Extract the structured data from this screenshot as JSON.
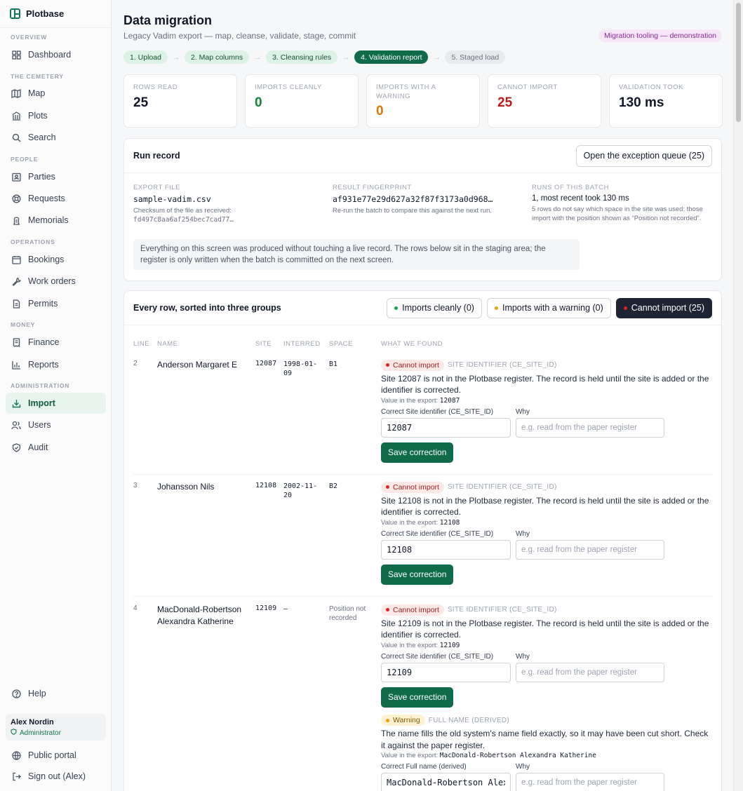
{
  "brand": "Plotbase",
  "nav": {
    "sections": [
      "OVERVIEW",
      "THE CEMETERY",
      "PEOPLE",
      "OPERATIONS",
      "MONEY",
      "ADMINISTRATION"
    ],
    "items": [
      {
        "label": "Dashboard",
        "icon": "grid-icon"
      },
      {
        "label": "Map",
        "icon": "map-icon"
      },
      {
        "label": "Plots",
        "icon": "building-icon"
      },
      {
        "label": "Search",
        "icon": "search-icon"
      },
      {
        "label": "Parties",
        "icon": "id-card-icon"
      },
      {
        "label": "Requests",
        "icon": "lifebuoy-icon"
      },
      {
        "label": "Memorials",
        "icon": "memorial-icon"
      },
      {
        "label": "Bookings",
        "icon": "calendar-icon"
      },
      {
        "label": "Work orders",
        "icon": "wrench-icon"
      },
      {
        "label": "Permits",
        "icon": "document-icon"
      },
      {
        "label": "Finance",
        "icon": "receipt-icon"
      },
      {
        "label": "Reports",
        "icon": "bar-chart-icon"
      },
      {
        "label": "Import",
        "icon": "import-icon",
        "active": true
      },
      {
        "label": "Users",
        "icon": "users-icon"
      },
      {
        "label": "Audit",
        "icon": "shield-icon"
      }
    ],
    "help": "Help",
    "user_name": "Alex Nordin",
    "user_role": "Administrator",
    "public_portal": "Public portal",
    "sign_out": "Sign out (Alex)"
  },
  "header": {
    "title": "Data migration",
    "subtitle": "Legacy Vadim export — map, cleanse, validate, stage, commit",
    "badge": "Migration tooling — demonstration"
  },
  "steps": [
    {
      "label": "1. Upload",
      "state": "done"
    },
    {
      "label": "2. Map columns",
      "state": "done"
    },
    {
      "label": "3. Cleansing rules",
      "state": "done"
    },
    {
      "label": "4. Validation report",
      "state": "current"
    },
    {
      "label": "5. Staged load",
      "state": "todo"
    }
  ],
  "stats": [
    {
      "label": "ROWS READ",
      "value": "25",
      "tone": ""
    },
    {
      "label": "IMPORTS CLEANLY",
      "value": "0",
      "tone": "green"
    },
    {
      "label": "IMPORTS WITH A WARNING",
      "value": "0",
      "tone": "orange"
    },
    {
      "label": "CANNOT IMPORT",
      "value": "25",
      "tone": "red"
    },
    {
      "label": "VALIDATION TOOK",
      "value": "130 ms",
      "tone": ""
    }
  ],
  "run_record": {
    "title": "Run record",
    "queue_button": "Open the exception queue (25)",
    "export_label": "EXPORT FILE",
    "export_value": "sample-vadim.csv",
    "export_note": "Checksum of the file as received:",
    "export_checksum": "fd497c8aa6af254bec7cad77…",
    "fingerprint_label": "RESULT FINGERPRINT",
    "fingerprint_value": "af931e77e29d627a32f87f3173a0d968…",
    "fingerprint_note": "Re-run the batch to compare this against the next run.",
    "runs_label": "RUNS OF THIS BATCH",
    "runs_value": "1, most recent took 130 ms",
    "runs_note": "5 rows do not say which space in the site was used; those import with the position shown as “Position not recorded”.",
    "notice": "Everything on this screen was produced without touching a live record. The rows below sit in the staging area; the register is only written when the batch is committed on the next screen."
  },
  "rows_card": {
    "title": "Every row, sorted into three groups",
    "filter_clean": "Imports cleanly (0)",
    "filter_warning": "Imports with a warning (0)",
    "filter_cannot": "Cannot import (25)",
    "columns": [
      "LINE",
      "NAME",
      "SITE",
      "INTERRED",
      "SPACE",
      "WHAT WE FOUND"
    ]
  },
  "rows": [
    {
      "line": "2",
      "name": "Anderson Margaret E",
      "site": "12087",
      "interred": "1998-01-09",
      "space": "B1",
      "findings": [
        {
          "tag": "Cannot import",
          "field": "SITE IDENTIFIER (CE_SITE_ID)",
          "text": "Site 12087 is not in the Plotbase register. The record is held until the site is added or the identifier is corrected.",
          "value_prefix": "Value in the export:",
          "value": "12087",
          "correct_label": "Correct Site identifier (CE_SITE_ID)",
          "why_label": "Why",
          "input_value": "12087",
          "why_placeholder": "e.g. read from the paper register",
          "save": "Save correction"
        }
      ]
    },
    {
      "line": "3",
      "name": "Johansson Nils",
      "site": "12108",
      "interred": "2002-11-20",
      "space": "B2",
      "findings": [
        {
          "tag": "Cannot import",
          "field": "SITE IDENTIFIER (CE_SITE_ID)",
          "text": "Site 12108 is not in the Plotbase register. The record is held until the site is added or the identifier is corrected.",
          "value_prefix": "Value in the export:",
          "value": "12108",
          "correct_label": "Correct Site identifier (CE_SITE_ID)",
          "why_label": "Why",
          "input_value": "12108",
          "why_placeholder": "e.g. read from the paper register",
          "save": "Save correction"
        }
      ]
    },
    {
      "line": "4",
      "name": "MacDonald-Robertson Alexandra Katherine",
      "site": "12109",
      "interred": "—",
      "space": "Position not recorded",
      "findings": [
        {
          "tag": "Cannot import",
          "field": "SITE IDENTIFIER (CE_SITE_ID)",
          "text": "Site 12109 is not in the Plotbase register. The record is held until the site is added or the identifier is corrected.",
          "value_prefix": "Value in the export:",
          "value": "12109",
          "correct_label": "Correct Site identifier (CE_SITE_ID)",
          "why_label": "Why",
          "input_value": "12109",
          "why_placeholder": "e.g. read from the paper register",
          "save": "Save correction"
        },
        {
          "tag": "Warning",
          "field": "FULL NAME (DERIVED)",
          "text": "The name fills the old system's name field exactly, so it may have been cut short. Check it against the paper register.",
          "value_prefix": "Value in the export:",
          "value": "MacDonald-Robertson Alexandra Katherine",
          "correct_label": "Correct Full name (derived)",
          "why_label": "Why",
          "input_value": "MacDonald-Robertson Alexandra Katherine",
          "why_placeholder": "e.g. read from the paper register"
        }
      ]
    }
  ],
  "colors": {
    "accent": "#0f6b4a",
    "danger": "#b91c1c",
    "warning": "#d97706",
    "dark": "#1e2433"
  }
}
